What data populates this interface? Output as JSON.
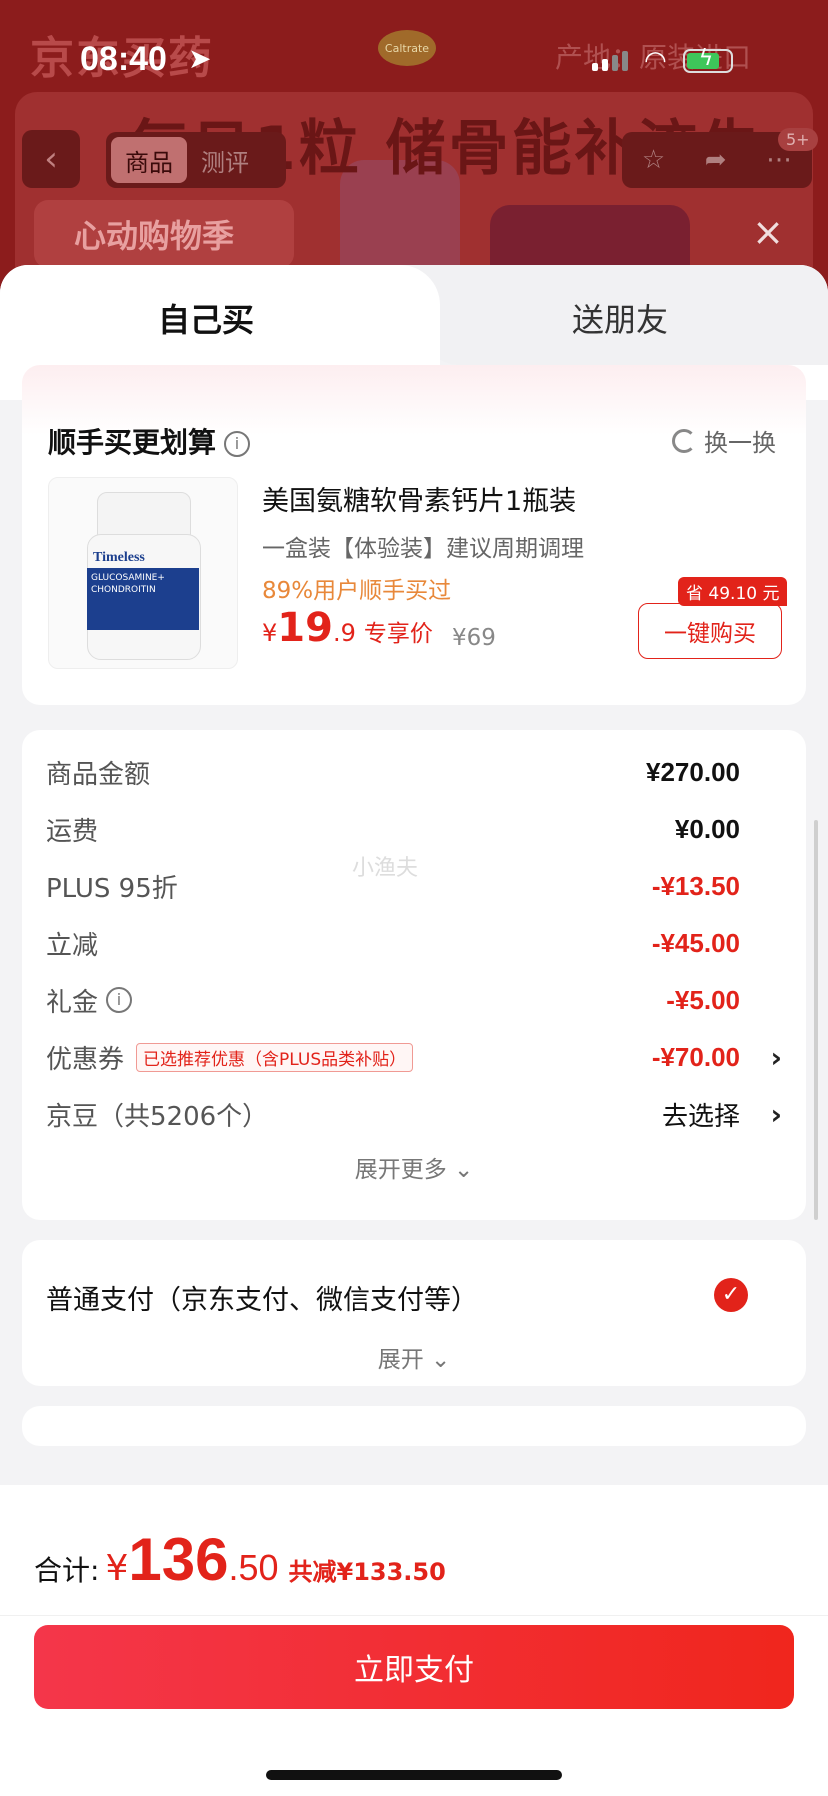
{
  "status_bar": {
    "time": "08:40"
  },
  "background_page": {
    "brand": "京东买药",
    "brand_logo": "Caltrate",
    "location": "产地：原装进口",
    "slogan": "每日1粒 储骨能补流失",
    "tabs": [
      "商品",
      "测评"
    ],
    "badge": "5+",
    "promo": "心动购物季"
  },
  "sheet": {
    "tabs": {
      "self": "自己买",
      "friend": "送朋友"
    }
  },
  "upsell": {
    "title": "顺手买更划算",
    "swap_label": "换一换",
    "product": {
      "image_brand": "Timeless",
      "image_label": "GLUCOSAMINE+ CHONDROITIN",
      "name": "美国氨糖软骨素钙片1瓶装",
      "desc": "一盒装【体验装】建议周期调理",
      "stat": "89%用户顺手买过",
      "price_yen": "¥",
      "price_int": "19",
      "price_dec": ".9",
      "price_tag": "专享价",
      "orig_price": "¥69",
      "save_tag": "省 49.10 元",
      "buy_label": "一键购买"
    }
  },
  "fees": {
    "rows": [
      {
        "label": "商品金额",
        "value": "¥270.00"
      },
      {
        "label": "运费",
        "value": "¥0.00"
      },
      {
        "label": "PLUS 95折",
        "value": "-¥13.50"
      },
      {
        "label": "立减",
        "value": "-¥45.00"
      },
      {
        "label": "礼金",
        "value": "-¥5.00"
      },
      {
        "label": "优惠券",
        "tag": "已选推荐优惠（含PLUS品类补贴）",
        "value": "-¥70.00"
      },
      {
        "label": "京豆（共5206个）",
        "value": "去选择"
      }
    ],
    "expand_more": "展开更多",
    "watermark": "小渔夫"
  },
  "payment": {
    "method": "普通支付（京东支付、微信支付等）",
    "expand": "展开"
  },
  "bottom": {
    "total_label": "合计:",
    "total_yen": "¥",
    "total_int": "136",
    "total_dec": ".50",
    "total_save": "共减¥133.50",
    "pay_button": "立即支付"
  },
  "colors": {
    "accent": "#e2231a",
    "orange": "#e8883a"
  }
}
